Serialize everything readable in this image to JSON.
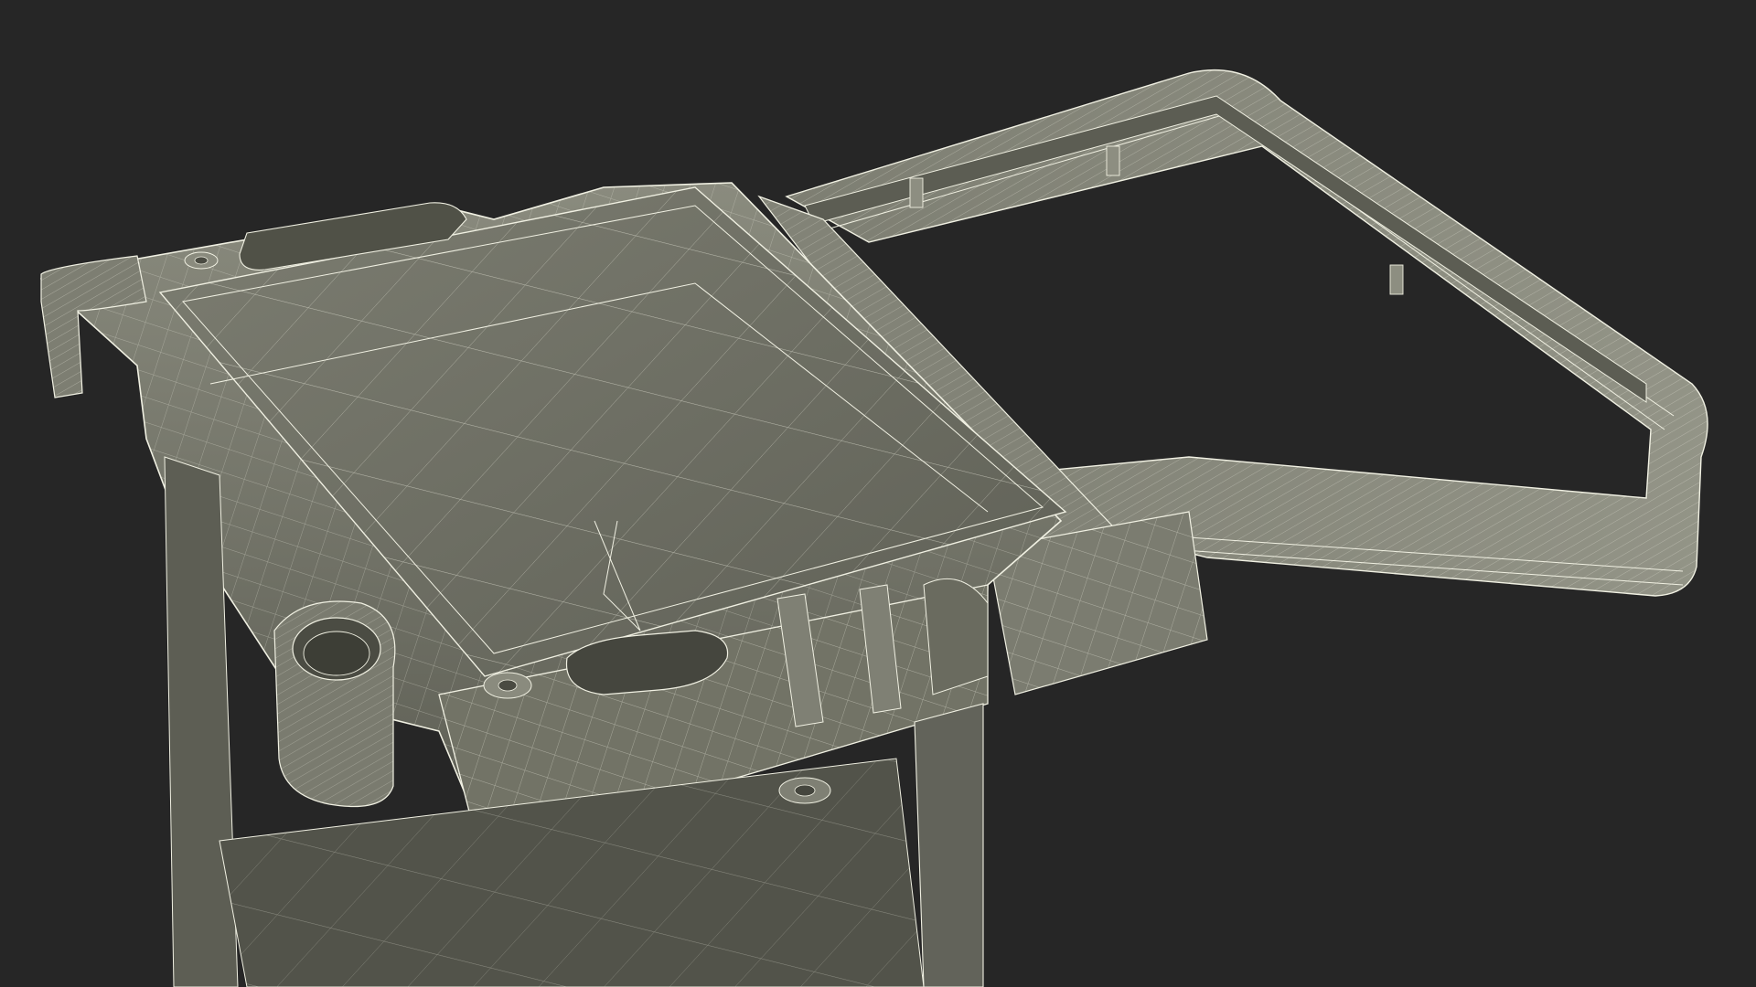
{
  "scene": {
    "subject": "",
    "background_color": "#262626",
    "surface_color": "#6f7064",
    "surface_light": "#8b8c7f",
    "surface_dark": "#55564c",
    "wire_color": "#f0f0e2"
  }
}
